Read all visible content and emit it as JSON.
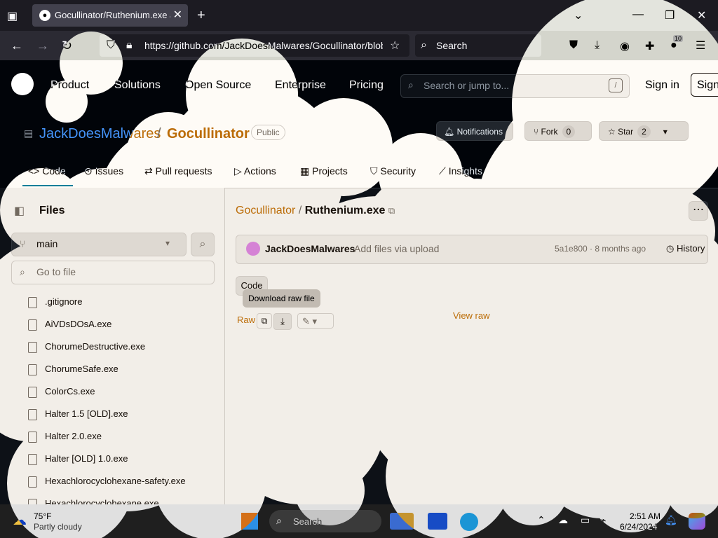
{
  "browser": {
    "tab_title": "Gocullinator/Ruthenium.exe at",
    "url": "https://github.com/JackDoesMalwares/Gocullinator/blob",
    "search_placeholder": "Search",
    "extension_badge": "10"
  },
  "github": {
    "nav": [
      "Product",
      "Solutions",
      "Open Source",
      "Enterprise",
      "Pricing"
    ],
    "search_placeholder": "Search or jump to...",
    "search_shortcut": "/",
    "sign_in": "Sign in",
    "sign_up": "Sign"
  },
  "repo": {
    "owner": "JackDoesMalwares",
    "separator": "/",
    "name": "Gocullinator",
    "visibility": "Public",
    "notifications_label": "Notifications",
    "fork_label": "Fork",
    "fork_count": "0",
    "star_label": "Star",
    "star_count": "2",
    "tabs": [
      "Code",
      "Issues",
      "Pull requests",
      "Actions",
      "Projects",
      "Security",
      "Insights"
    ]
  },
  "sidebar": {
    "title": "Files",
    "branch": "main",
    "goto_placeholder": "Go to file",
    "files": [
      ".gitignore",
      "AiVDsDOsA.exe",
      "ChorumeDestructive.exe",
      "ChorumeSafe.exe",
      "ColorCs.exe",
      "Halter 1.5 [OLD].exe",
      "Halter 2.0.exe",
      "Halter [OLD] 1.0.exe",
      "Hexachlorocyclohexane-safety.exe",
      "Hexachlorocyclohexane.exe"
    ]
  },
  "file_view": {
    "breadcrumb_repo": "Gocullinator",
    "breadcrumb_sep": "/",
    "breadcrumb_file": "Ruthenium.exe",
    "commit_author": "JackDoesMalwares",
    "commit_message": "Add files via upload",
    "commit_meta": "5a1e800 · 8 months ago",
    "history_label": "History",
    "code_tab": "Code",
    "tooltip": "Download raw file",
    "raw_label": "Raw",
    "view_raw": "View raw"
  },
  "taskbar": {
    "temp": "75°F",
    "weather": "Partly cloudy",
    "search": "Search",
    "time": "2:51 AM",
    "date": "6/24/2024"
  }
}
